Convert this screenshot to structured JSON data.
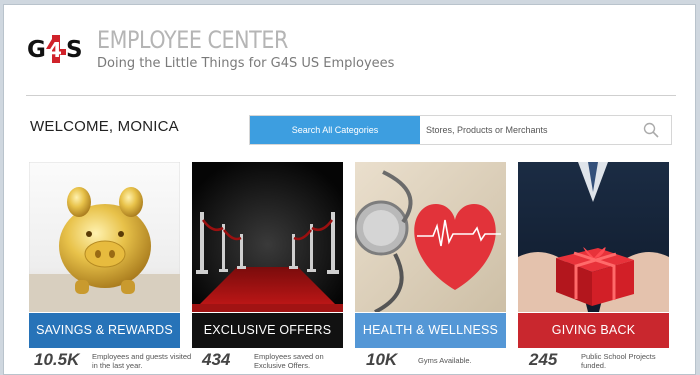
{
  "header": {
    "logo_text": "G4S",
    "title": "EMPLOYEE CENTER",
    "subtitle": "Doing the Little Things for G4S US Employees"
  },
  "welcome": "WELCOME, MONICA",
  "search": {
    "category_label": "Search All Categories",
    "placeholder": "Stores, Products or Merchants"
  },
  "colors": {
    "brand_red": "#d0222a",
    "accent_blue": "#3d9ee0",
    "savings_banner": "#2773b8",
    "exclusive_banner": "#111111",
    "health_banner": "#5497d6",
    "giving_banner": "#c9272e"
  },
  "cards": [
    {
      "label": "SAVINGS & REWARDS",
      "stat": "10.5K",
      "stat_text": "Employees and guests visited in the last year.",
      "icon": "piggy-bank-image"
    },
    {
      "label": "EXCLUSIVE OFFERS",
      "stat": "434",
      "stat_text": "Employees saved on Exclusive Offers.",
      "icon": "red-carpet-image"
    },
    {
      "label": "HEALTH & WELLNESS",
      "stat": "10K",
      "stat_text": "Gyms Available.",
      "icon": "stethoscope-heart-image"
    },
    {
      "label": "GIVING BACK",
      "stat": "245",
      "stat_text": "Public School Projects funded.",
      "icon": "gift-box-image"
    }
  ]
}
